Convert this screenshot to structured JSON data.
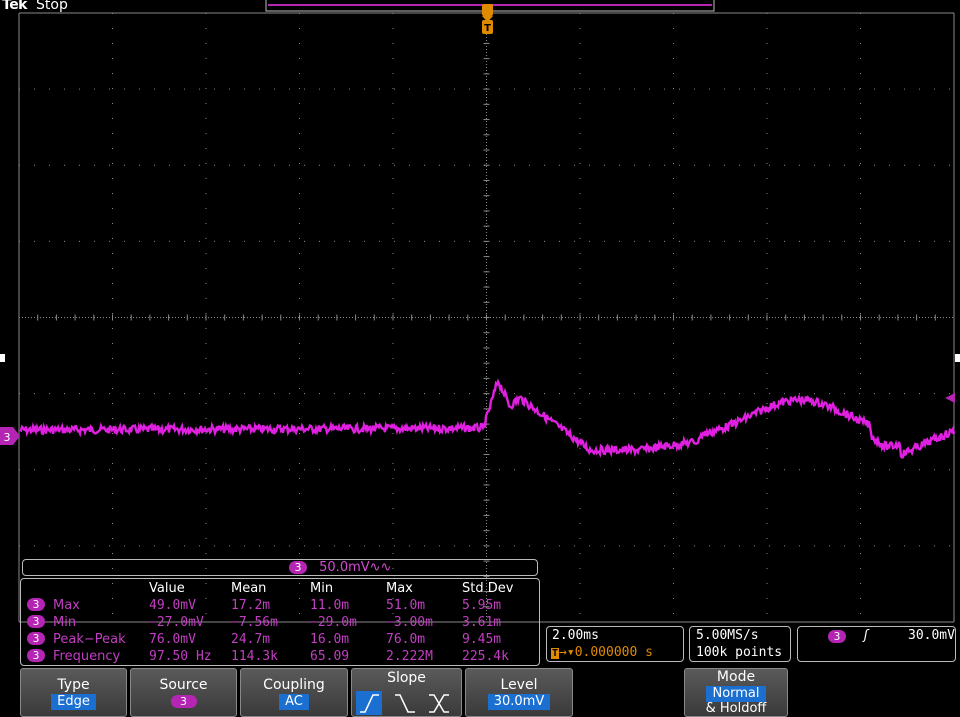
{
  "header": {
    "brand": "Tek",
    "status": "Stop"
  },
  "trigger_marker": "T",
  "channel_marker": "3",
  "colors": {
    "trace": "#e020e0",
    "grid": "#8a8a8a",
    "trigger": "#e08a00",
    "highlight": "#1a6fd0"
  },
  "channel_info": {
    "channel": "3",
    "scale": "50.0mV",
    "coupling_symbol": "∿∿"
  },
  "measurements": {
    "headers": [
      "Value",
      "Mean",
      "Min",
      "Max",
      "Std Dev"
    ],
    "rows": [
      {
        "ch": "3",
        "name": "Max",
        "value": "49.0mV",
        "mean": "17.2m",
        "min": "11.0m",
        "max": "51.0m",
        "std": "5.95m"
      },
      {
        "ch": "3",
        "name": "Min",
        "value": "−27.0mV",
        "mean": "−7.56m",
        "min": "−29.0m",
        "max": "−3.00m",
        "std": "3.61m"
      },
      {
        "ch": "3",
        "name": "Peak−Peak",
        "value": "76.0mV",
        "mean": "24.7m",
        "min": "16.0m",
        "max": "76.0m",
        "std": "9.45m"
      },
      {
        "ch": "3",
        "name": "Frequency",
        "value": "97.50 Hz",
        "mean": "114.3k",
        "min": "65.09",
        "max": "2.222M",
        "std": "225.4k"
      }
    ]
  },
  "timebase": {
    "scale": "2.00ms",
    "trigger_pos": "0.000000 s"
  },
  "acquisition": {
    "rate": "5.00MS/s",
    "points": "100k points"
  },
  "trigger": {
    "channel": "3",
    "slope_symbol": "ʃ",
    "level": "30.0mV"
  },
  "buttons": {
    "type": {
      "label": "Type",
      "value": "Edge"
    },
    "source": {
      "label": "Source",
      "value": "3"
    },
    "coupling": {
      "label": "Coupling",
      "value": "AC"
    },
    "slope": {
      "label": "Slope"
    },
    "level": {
      "label": "Level",
      "value": "30.0mV"
    },
    "mode": {
      "label": "Mode",
      "value": "Normal",
      "extra": "& Holdoff"
    }
  }
}
